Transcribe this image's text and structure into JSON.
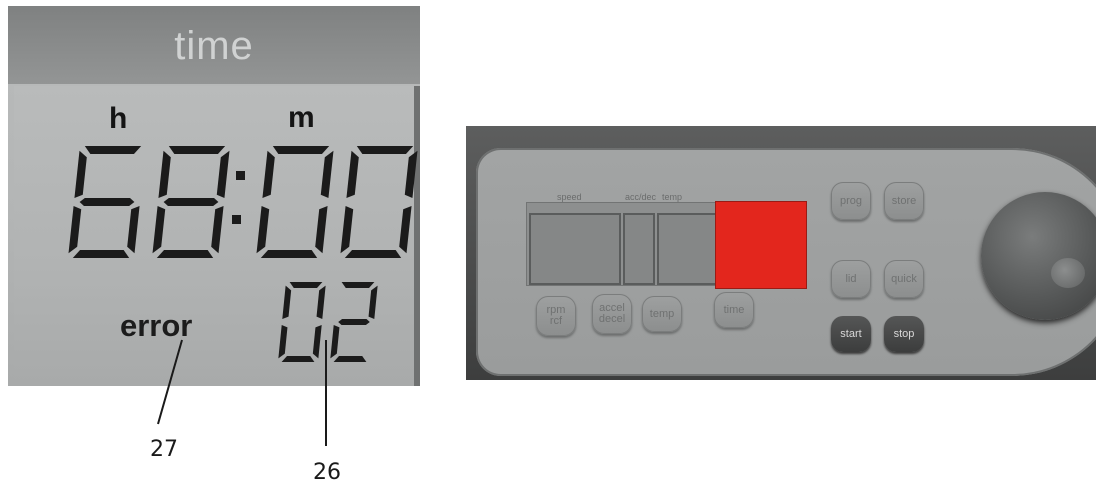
{
  "lcd": {
    "caption": "time",
    "hours_unit": "h",
    "minutes_unit": "m",
    "time_display": "68:00",
    "error_label": "error",
    "error_code": "02"
  },
  "callouts": {
    "error_label_ref": "27",
    "error_code_ref": "26"
  },
  "panel": {
    "display_labels": [
      "speed",
      "acc/dec",
      "temp"
    ],
    "buttons": {
      "rpm_rcf": "rpm\nrcf",
      "accel_decel": "accel\ndecel",
      "temp": "temp",
      "time": "time",
      "prog": "prog",
      "store": "store",
      "lid": "lid",
      "quick": "quick",
      "start": "start",
      "stop": "stop"
    },
    "colors": {
      "highlight": "#e3261d",
      "dark_button": "#444545"
    }
  }
}
